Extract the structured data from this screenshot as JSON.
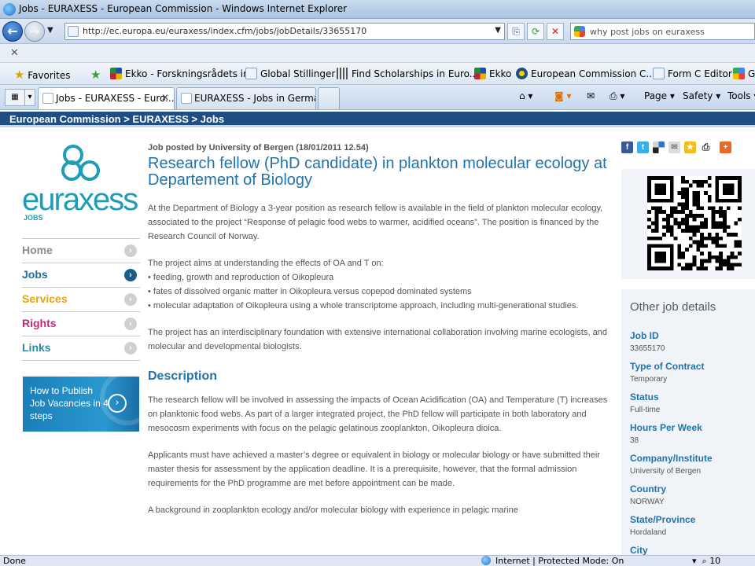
{
  "window": {
    "title": "Jobs - EURAXESS - European Commission - Windows Internet Explorer"
  },
  "address": {
    "url": "http://ec.europa.eu/euraxess/index.cfm/jobs/jobDetails/33655170",
    "search_placeholder": "why post jobs on euraxess"
  },
  "favorites": {
    "label": "Favorites",
    "items": [
      {
        "label": "Ekko - Forskningsrådets in...",
        "icon": "ekko-icon"
      },
      {
        "label": "Global Stillinger",
        "icon": "page-icon"
      },
      {
        "label": "Find Scholarships in Euro...",
        "icon": "columns-icon"
      },
      {
        "label": "Ekko",
        "icon": "ekko-icon"
      },
      {
        "label": "European Commission C...",
        "icon": "eu-icon"
      },
      {
        "label": "Form C Editor",
        "icon": "page-icon"
      },
      {
        "label": "G",
        "icon": "google-icon"
      }
    ]
  },
  "tabs": [
    {
      "label": "Jobs - EURAXESS - Euro...",
      "active": true
    },
    {
      "label": "EURAXESS - Jobs in Germa...",
      "active": false
    }
  ],
  "commandbar": {
    "page": "Page",
    "safety": "Safety",
    "tools": "Tools"
  },
  "site": {
    "breadcrumb": "European Commission > EURAXESS > Jobs",
    "logo_word": "euraxess",
    "logo_sub": "JOBS"
  },
  "nav": [
    {
      "label": "Home",
      "color": "#8a8a8a"
    },
    {
      "label": "Jobs",
      "color": "#1a6ea5"
    },
    {
      "label": "Services",
      "color": "#e8a50d"
    },
    {
      "label": "Rights",
      "color": "#c8287a"
    },
    {
      "label": "Links",
      "color": "#2b8aa6"
    }
  ],
  "banner": {
    "text": "How to Publish Job Vacancies in 4 steps"
  },
  "job": {
    "posted": "Job posted by University of Bergen (18/01/2011 12.54)",
    "title": "Research fellow (PhD candidate) in plankton molecular ecology at Departement of Biology",
    "intro": [
      "At the Department of Biology a 3-year position as research fellow is available in the field of plankton molecular ecology, associated to the project “Response of pelagic food webs to warmer, acidified oceans”. The position is financed by the Research Council of Norway."
    ],
    "aims": [
      "The project aims at understanding the effects of OA and T on:",
      "• feeding, growth and reproduction of Oikopleura",
      "• fates of dissolved organic matter in Oikopleura versus copepod dominated systems",
      "• molecular adaptation of Oikopleura using a whole transcriptome approach, including multi-generational studies."
    ],
    "foundation": "The project has an interdisciplinary foundation with extensive international collaboration involving marine ecologists, and molecular and developmental biologists.",
    "description_heading": "Description",
    "description": [
      "The research fellow will be involved in assessing the impacts of Ocean Acidification (OA) and Temperature (T) increases on planktonic food webs. As part of a larger integrated project, the PhD fellow will participate in both laboratory and mesocosm experiments with focus on the pelagic gelatinous zooplankton, Oikopleura dioica.",
      "Applicants must have achieved a master’s degree or equivalent in biology or molecular biology or have submitted their master thesis for assessment by the application deadline. It is a prerequisite, however, that the formal admission requirements for the PhD programme are met before appointment can be made.",
      "A background in zooplankton ecology and/or molecular biology with experience in pelagic marine"
    ]
  },
  "details": {
    "heading": "Other job details",
    "items": [
      {
        "key": "Job ID",
        "value": "33655170"
      },
      {
        "key": "Type of Contract",
        "value": "Temporary"
      },
      {
        "key": "Status",
        "value": "Full-time"
      },
      {
        "key": "Hours Per Week",
        "value": "38"
      },
      {
        "key": "Company/Institute",
        "value": "University of Bergen"
      },
      {
        "key": "Country",
        "value": "NORWAY"
      },
      {
        "key": "State/Province",
        "value": "Hordaland"
      },
      {
        "key": "City",
        "value": ""
      }
    ]
  },
  "share_icons": [
    "facebook-icon",
    "twitter-icon",
    "delicious-icon",
    "email-icon",
    "bookmark-star-icon",
    "print-icon",
    "addthis-icon"
  ],
  "status": {
    "left": "Done",
    "zone": "Internet | Protected Mode: On",
    "zoom": "10"
  },
  "colors": {
    "eu_blue": "#1f4e85",
    "title_blue": "#2173ad",
    "panel": "#f0f4f8"
  }
}
